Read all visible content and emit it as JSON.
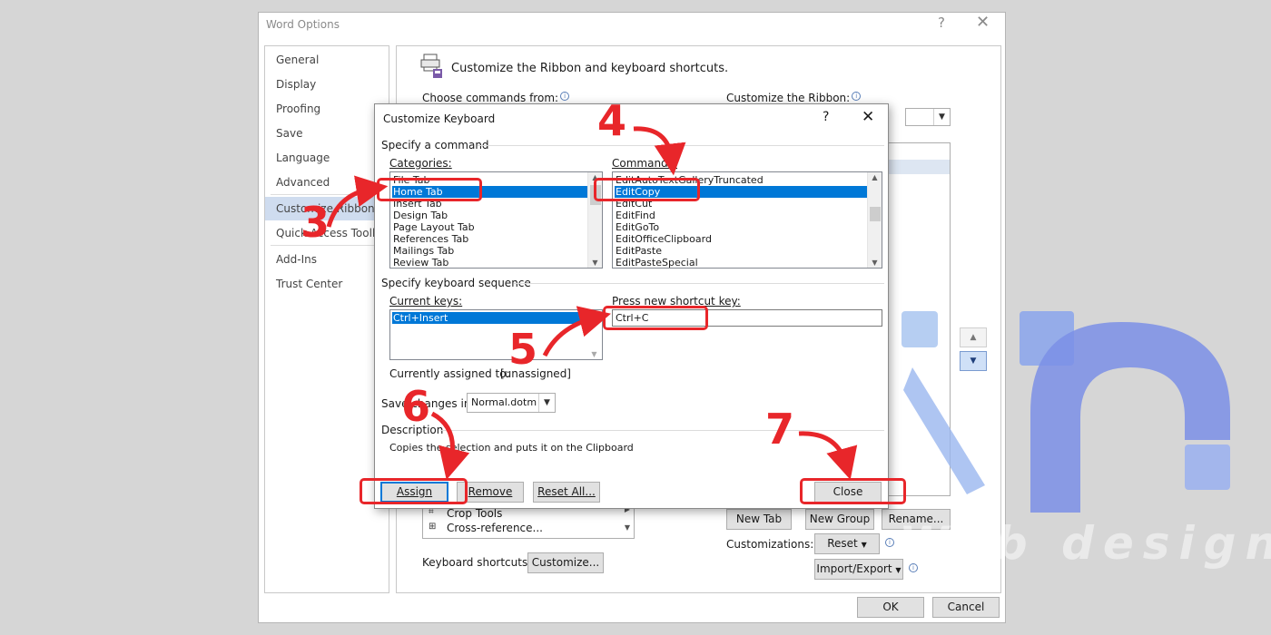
{
  "word_options": {
    "title": "Word Options",
    "help_glyph": "?",
    "close_glyph": "✕",
    "nav": [
      {
        "label": "General"
      },
      {
        "label": "Display"
      },
      {
        "label": "Proofing"
      },
      {
        "label": "Save"
      },
      {
        "label": "Language"
      },
      {
        "label": "Advanced"
      },
      {
        "label": "Customize Ribbon",
        "selected": true
      },
      {
        "label": "Quick Access Toolbar"
      },
      {
        "label": "Add-Ins"
      },
      {
        "label": "Trust Center"
      }
    ],
    "header": "Customize the Ribbon and keyboard shortcuts.",
    "choose_commands_label": "Choose commands from:",
    "customize_ribbon_label": "Customize the Ribbon:",
    "commands_list": [
      "Crop Tools",
      "Cross-reference..."
    ],
    "keyboard_shortcuts_label": "Keyboard shortcuts:",
    "customize_button": "Customize...",
    "new_tab_button": "New Tab",
    "new_group_button": "New Group",
    "rename_button": "Rename...",
    "customizations_label": "Customizations:",
    "reset_button": "Reset",
    "import_export_button": "Import/Export",
    "ok_button": "OK",
    "cancel_button": "Cancel"
  },
  "customize_keyboard": {
    "title": "Customize Keyboard",
    "help_glyph": "?",
    "close_glyph": "✕",
    "specify_command": "Specify a command",
    "categories_label": "Categories:",
    "categories": [
      "File Tab",
      "Home Tab",
      "Insert Tab",
      "Design Tab",
      "Page Layout Tab",
      "References Tab",
      "Mailings Tab",
      "Review Tab"
    ],
    "selected_category": "Home Tab",
    "commands_label": "Commands:",
    "commands": [
      "EditAutoTextGalleryTruncated",
      "EditCopy",
      "EditCut",
      "EditFind",
      "EditGoTo",
      "EditOfficeClipboard",
      "EditPaste",
      "EditPasteSpecial"
    ],
    "selected_command": "EditCopy",
    "specify_sequence": "Specify keyboard sequence",
    "current_keys_label": "Current keys:",
    "current_keys": [
      "Ctrl+Insert"
    ],
    "press_new_label": "Press new shortcut key:",
    "new_shortcut_value": "Ctrl+C",
    "assigned_to_label": "Currently assigned to:",
    "assigned_to_value": "[unassigned]",
    "save_changes_label": "Save changes in:",
    "save_changes_value": "Normal.dotm",
    "description_label": "Description",
    "description_text": "Copies the selection and puts it on the Clipboard",
    "assign_button": "Assign",
    "remove_button": "Remove",
    "reset_all_button": "Reset All...",
    "close_button": "Close"
  },
  "annotations": {
    "color": "#e8262a",
    "steps": [
      "3",
      "4",
      "5",
      "6",
      "7"
    ]
  },
  "watermark": {
    "text": "Web design",
    "colors": [
      "#7b8fe6",
      "#a9c6f0"
    ]
  },
  "colors": {
    "selection": "#0078d7",
    "nav_selected": "#cfdcef"
  }
}
